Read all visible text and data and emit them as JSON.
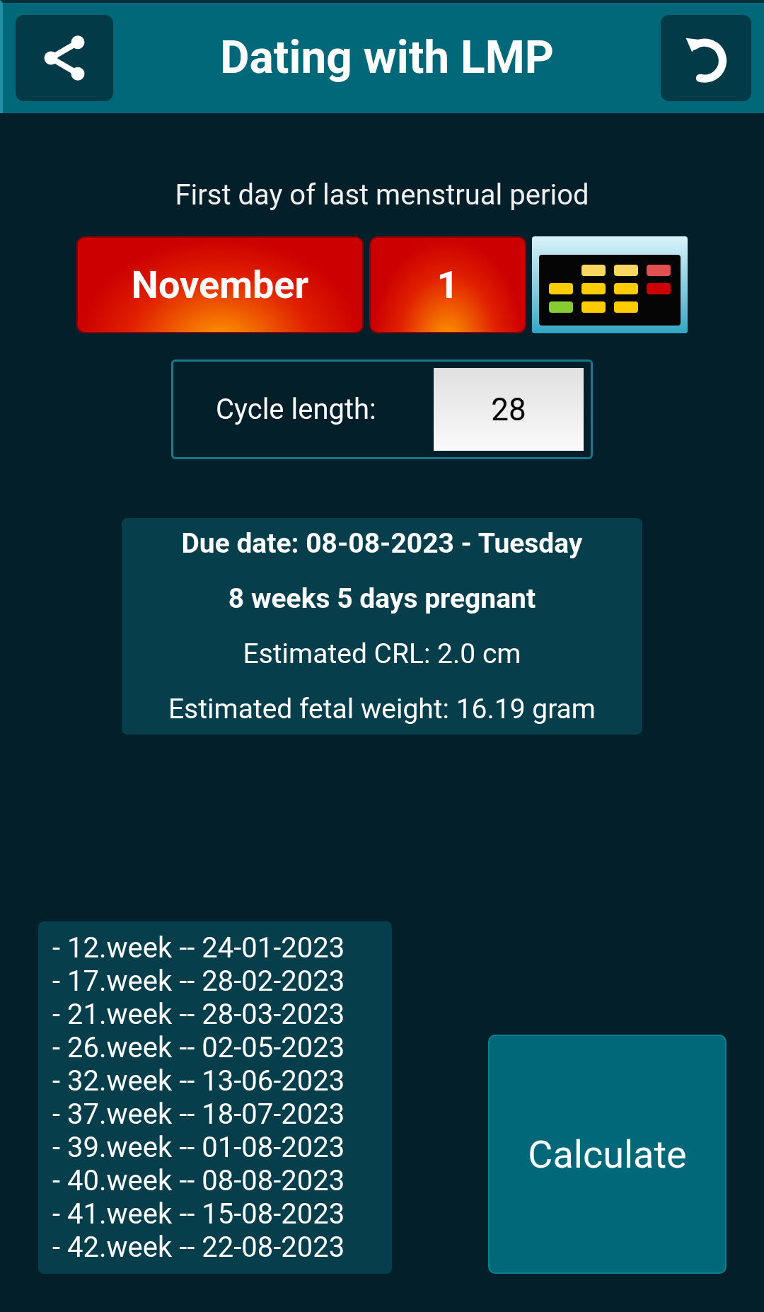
{
  "header": {
    "title": "Dating with LMP"
  },
  "lmp": {
    "label": "First day of last menstrual period",
    "month": "November",
    "day": "1"
  },
  "cycle": {
    "label": "Cycle length:",
    "value": "28"
  },
  "results": [
    {
      "text": "Due date: 08-08-2023 - Tuesday",
      "bold": true
    },
    {
      "text": "8 weeks 5 days pregnant",
      "bold": true
    },
    {
      "text": "Estimated CRL: 2.0 cm",
      "bold": false
    },
    {
      "text": "Estimated fetal weight: 16.19 gram",
      "bold": false
    }
  ],
  "milestones": [
    "- 12.week -- 24-01-2023",
    "- 17.week -- 28-02-2023",
    "- 21.week -- 28-03-2023",
    "- 26.week -- 02-05-2023",
    "- 32.week -- 13-06-2023",
    "- 37.week -- 18-07-2023",
    "- 39.week -- 01-08-2023",
    "- 40.week -- 08-08-2023",
    "- 41.week -- 15-08-2023",
    "- 42.week -- 22-08-2023"
  ],
  "calculate_button": "Calculate"
}
